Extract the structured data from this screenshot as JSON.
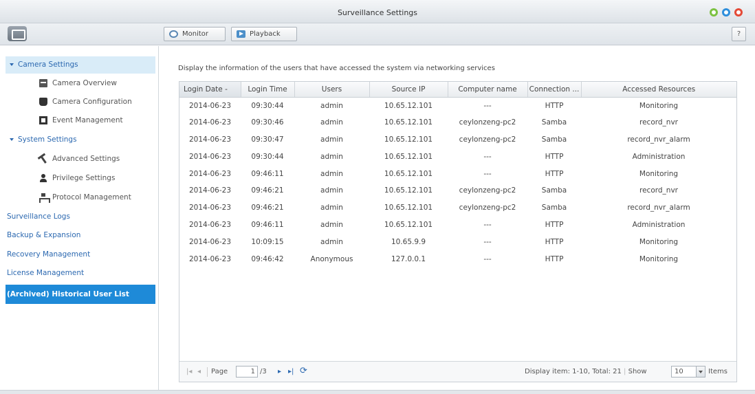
{
  "window": {
    "title": "Surveillance Settings"
  },
  "toolbar": {
    "monitor_label": "Monitor",
    "playback_label": "Playback",
    "help_label": "?"
  },
  "sidebar": {
    "camera_settings": "Camera Settings",
    "camera_overview": "Camera Overview",
    "camera_configuration": "Camera Configuration",
    "event_management": "Event Management",
    "system_settings": "System Settings",
    "advanced_settings": "Advanced Settings",
    "privilege_settings": "Privilege Settings",
    "protocol_management": "Protocol Management",
    "surveillance_logs": "Surveillance Logs",
    "backup_expansion": "Backup & Expansion",
    "recovery_management": "Recovery Management",
    "license_management": "License Management",
    "historical_user_list": "(Archived) Historical User List"
  },
  "main": {
    "description": "Display the information of the users that have accessed the system via networking services",
    "columns": [
      "Login Date",
      "Login Time",
      "Users",
      "Source IP",
      "Computer name",
      "Connection ...",
      "Accessed Resources"
    ],
    "sort_indicator": "-",
    "rows": [
      [
        "2014-06-23",
        "09:30:44",
        "admin",
        "10.65.12.101",
        "---",
        "HTTP",
        "Monitoring"
      ],
      [
        "2014-06-23",
        "09:30:46",
        "admin",
        "10.65.12.101",
        "ceylonzeng-pc2",
        "Samba",
        "record_nvr"
      ],
      [
        "2014-06-23",
        "09:30:47",
        "admin",
        "10.65.12.101",
        "ceylonzeng-pc2",
        "Samba",
        "record_nvr_alarm"
      ],
      [
        "2014-06-23",
        "09:30:44",
        "admin",
        "10.65.12.101",
        "---",
        "HTTP",
        "Administration"
      ],
      [
        "2014-06-23",
        "09:46:11",
        "admin",
        "10.65.12.101",
        "---",
        "HTTP",
        "Monitoring"
      ],
      [
        "2014-06-23",
        "09:46:21",
        "admin",
        "10.65.12.101",
        "ceylonzeng-pc2",
        "Samba",
        "record_nvr"
      ],
      [
        "2014-06-23",
        "09:46:21",
        "admin",
        "10.65.12.101",
        "ceylonzeng-pc2",
        "Samba",
        "record_nvr_alarm"
      ],
      [
        "2014-06-23",
        "09:46:11",
        "admin",
        "10.65.12.101",
        "---",
        "HTTP",
        "Administration"
      ],
      [
        "2014-06-23",
        "10:09:15",
        "admin",
        "10.65.9.9",
        "---",
        "HTTP",
        "Monitoring"
      ],
      [
        "2014-06-23",
        "09:46:42",
        "Anonymous",
        "127.0.0.1",
        "---",
        "HTTP",
        "Monitoring"
      ]
    ]
  },
  "pager": {
    "page_label": "Page",
    "page_value": "1",
    "of_total": "/3",
    "display_info": "Display item: 1-10, Total: 21",
    "show_label": "Show",
    "show_value": "10",
    "items_label": "Items"
  },
  "icons": {
    "first": "first-page-icon",
    "prev": "prev-page-icon",
    "next": "next-page-icon",
    "last": "last-page-icon",
    "refresh": "refresh-icon"
  },
  "colors": {
    "selected_light": "#d9ecf8",
    "selected_dark": "#1e8ad8",
    "link_blue": "#2b68b0",
    "win_min": "#7cc242",
    "win_max": "#2f8fdc",
    "win_close": "#e44a37"
  }
}
